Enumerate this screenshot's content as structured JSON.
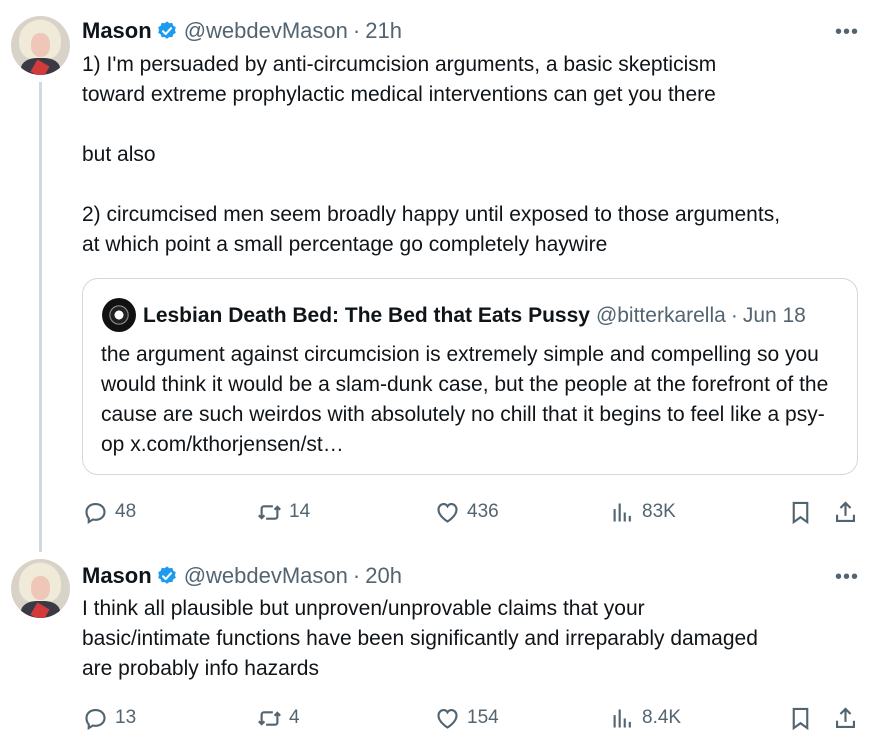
{
  "tweets": [
    {
      "author": {
        "name": "Mason",
        "handle": "@webdevMason",
        "verified": true,
        "verified_color": "#1d9bf0"
      },
      "time": "21h",
      "separator": "·",
      "text": "1) I'm persuaded by anti-circumcision arguments, a basic skepticism\ntoward extreme prophylactic medical interventions can get you there\n\nbut also\n\n2) circumcised men seem broadly happy until exposed to those arguments,\nat which point a small percentage go completely haywire",
      "quote": {
        "name": "Lesbian Death Bed: The Bed that Eats Pussy",
        "handle": "@bitterkarella",
        "separator": "·",
        "time": "Jun 18",
        "text": "the argument against circumcision is extremely simple and compelling so you would think it would be a slam-dunk case, but the people at the forefront of the cause are such weirdos with absolutely no chill that it begins to feel like a psy-op x.com/kthorjensen/st…"
      },
      "stats": {
        "replies": "48",
        "reposts": "14",
        "likes": "436",
        "views": "83K"
      }
    },
    {
      "author": {
        "name": "Mason",
        "handle": "@webdevMason",
        "verified": true,
        "verified_color": "#1d9bf0"
      },
      "time": "20h",
      "separator": "·",
      "text": "I think all plausible but unproven/unprovable claims that your\nbasic/intimate functions have been significantly and irreparably damaged\nare probably info hazards",
      "stats": {
        "replies": "13",
        "reposts": "4",
        "likes": "154",
        "views": "8.4K"
      }
    }
  ],
  "icons": {
    "reply": "reply-icon",
    "repost": "repost-icon",
    "like": "heart-icon",
    "views": "views-icon",
    "bookmark": "bookmark-icon",
    "share": "share-icon",
    "more": "more-icon",
    "verified": "verified-badge-icon"
  },
  "more_glyph": "•••"
}
